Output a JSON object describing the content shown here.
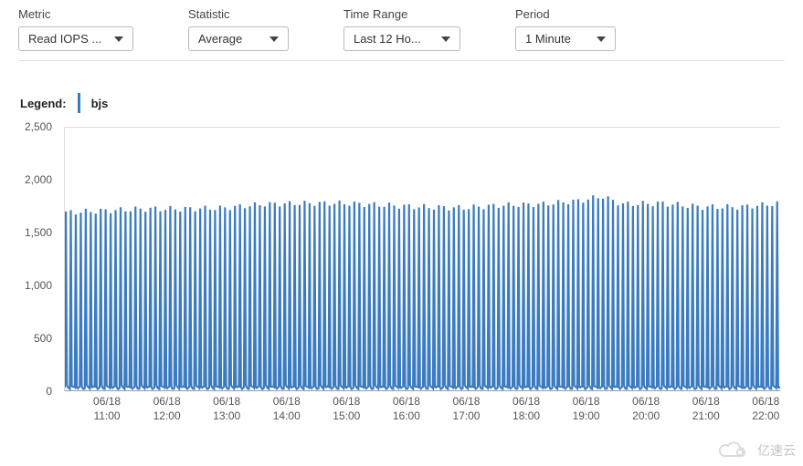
{
  "controls": {
    "metric": {
      "label": "Metric",
      "value": "Read IOPS ..."
    },
    "statistic": {
      "label": "Statistic",
      "value": "Average"
    },
    "timerange": {
      "label": "Time Range",
      "value": "Last 12 Ho..."
    },
    "period": {
      "label": "Period",
      "value": "1 Minute"
    }
  },
  "legend": {
    "label": "Legend:",
    "series_name": "bjs"
  },
  "chart_data": {
    "type": "line",
    "title": "",
    "xlabel": "",
    "ylabel": "",
    "ylim": [
      0,
      2500
    ],
    "y_ticks": [
      0,
      500,
      1000,
      1500,
      2000,
      2500
    ],
    "x_ticks": [
      {
        "date": "06/18",
        "time": "11:00"
      },
      {
        "date": "06/18",
        "time": "12:00"
      },
      {
        "date": "06/18",
        "time": "13:00"
      },
      {
        "date": "06/18",
        "time": "14:00"
      },
      {
        "date": "06/18",
        "time": "15:00"
      },
      {
        "date": "06/18",
        "time": "16:00"
      },
      {
        "date": "06/18",
        "time": "17:00"
      },
      {
        "date": "06/18",
        "time": "18:00"
      },
      {
        "date": "06/18",
        "time": "19:00"
      },
      {
        "date": "06/18",
        "time": "20:00"
      },
      {
        "date": "06/18",
        "time": "21:00"
      },
      {
        "date": "06/18",
        "time": "22:00"
      }
    ],
    "series": [
      {
        "name": "bjs",
        "color": "#3b7bbf",
        "approx_peak": 2075,
        "approx_trough": 25,
        "pattern": "dense sawtooth oscillation every ~5 minutes between ~25 and ~1800-2075 IOPS",
        "envelope_low": [
          [
            0,
            1900
          ],
          [
            40,
            1920
          ],
          [
            80,
            1940
          ],
          [
            120,
            1940
          ],
          [
            160,
            1950
          ],
          [
            200,
            1990
          ],
          [
            240,
            2000
          ],
          [
            280,
            2000
          ],
          [
            320,
            1980
          ],
          [
            360,
            1960
          ],
          [
            400,
            1950
          ],
          [
            440,
            1980
          ],
          [
            480,
            1990
          ],
          [
            520,
            2030
          ],
          [
            540,
            2075
          ],
          [
            560,
            1990
          ],
          [
            600,
            2000
          ],
          [
            640,
            1960
          ],
          [
            680,
            1960
          ],
          [
            719,
            2000
          ]
        ],
        "envelope_high": [
          [
            0,
            1750
          ],
          [
            60,
            1770
          ],
          [
            120,
            1790
          ],
          [
            180,
            1800
          ],
          [
            240,
            1810
          ],
          [
            300,
            1830
          ],
          [
            360,
            1820
          ],
          [
            420,
            1800
          ],
          [
            480,
            1820
          ],
          [
            540,
            1840
          ],
          [
            600,
            1800
          ],
          [
            660,
            1790
          ],
          [
            719,
            1780
          ]
        ]
      }
    ]
  },
  "watermark": "亿速云"
}
